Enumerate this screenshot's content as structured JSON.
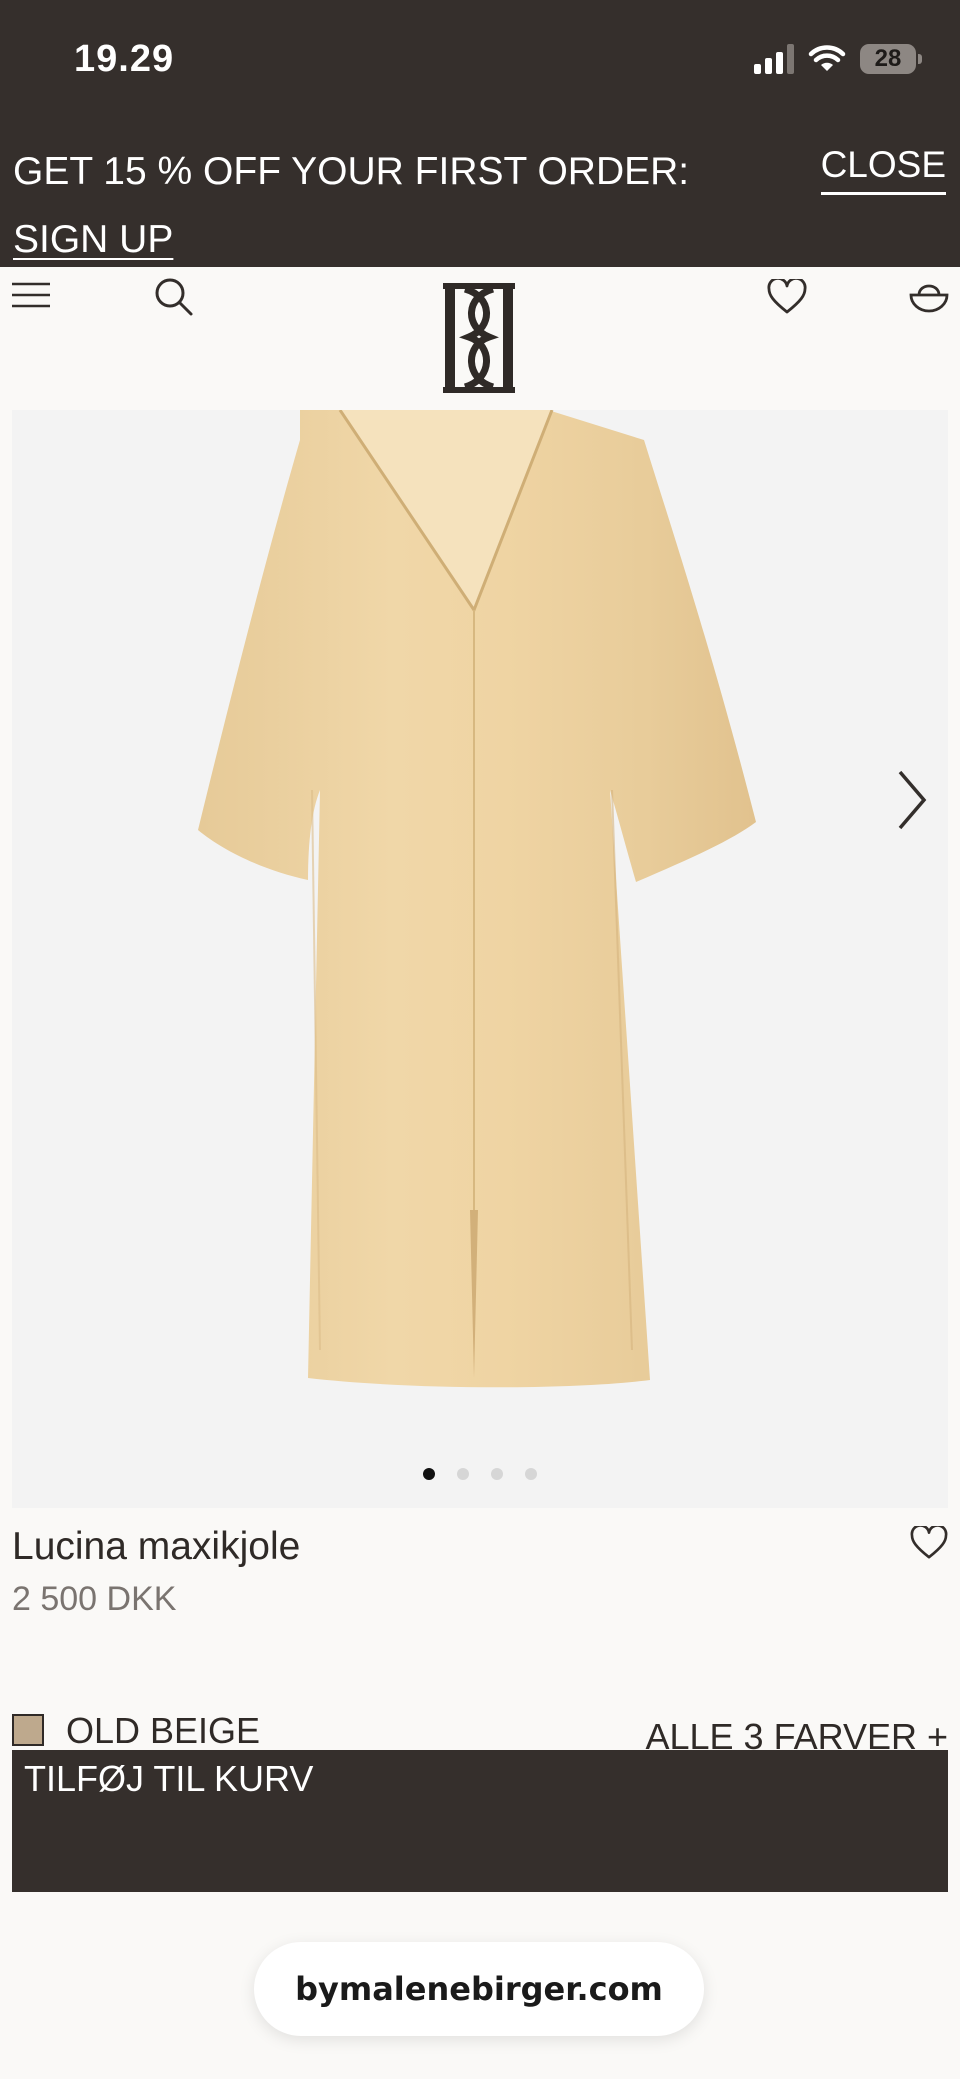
{
  "status": {
    "time": "19.29",
    "battery": "28"
  },
  "promo": {
    "text": "GET 15 % OFF YOUR FIRST ORDER:",
    "signup": "SIGN UP",
    "close": "CLOSE"
  },
  "nav": {
    "icons": [
      "menu-icon",
      "search-icon",
      "brand-logo",
      "heart-icon",
      "basket-icon"
    ]
  },
  "gallery": {
    "image_count": 4,
    "active_index": 0
  },
  "product": {
    "name": "Lucina maxikjole",
    "price": "2 500 DKK",
    "color_name": "OLD BEIGE",
    "all_colors": "ALLE 3 FARVER +",
    "swatch_color": "#bea98d",
    "dress_color": "#e8cf9e"
  },
  "cta": {
    "add_to_cart": "TILFØJ TIL KURV"
  },
  "browser": {
    "url": "bymalenebirger.com"
  },
  "colors": {
    "dark": "#352f2c",
    "background": "#faf9f7"
  }
}
